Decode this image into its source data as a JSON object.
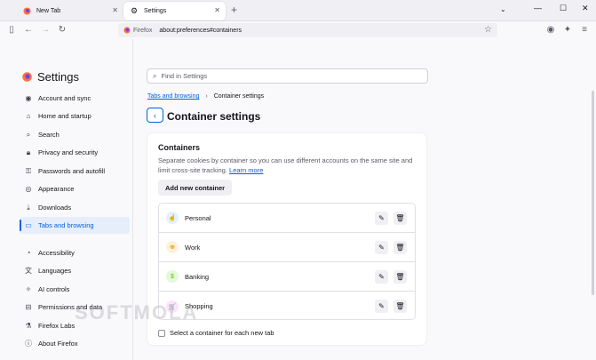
{
  "tabs": [
    {
      "label": "New Tab",
      "icon": "firefox-icon"
    },
    {
      "label": "Settings",
      "icon": "gear-icon"
    }
  ],
  "urlbar": {
    "identity": "Firefox",
    "url": "about:preferences#containers"
  },
  "sidebar": {
    "title": "Settings",
    "items": [
      {
        "label": "Account and sync",
        "icon": "account-icon"
      },
      {
        "label": "Home and startup",
        "icon": "home-icon"
      },
      {
        "label": "Search",
        "icon": "search-icon"
      },
      {
        "label": "Privacy and security",
        "icon": "lock-icon"
      },
      {
        "label": "Passwords and autofill",
        "icon": "key-icon"
      },
      {
        "label": "Appearance",
        "icon": "eye-icon"
      },
      {
        "label": "Downloads",
        "icon": "download-icon"
      },
      {
        "label": "Tabs and browsing",
        "icon": "tabs-icon",
        "selected": true
      },
      {
        "label": "Accessibility",
        "icon": "accessibility-icon"
      },
      {
        "label": "Languages",
        "icon": "translate-icon"
      },
      {
        "label": "AI controls",
        "icon": "sparkle-icon"
      },
      {
        "label": "Permissions and data",
        "icon": "permissions-icon"
      },
      {
        "label": "Firefox Labs",
        "icon": "flask-icon"
      },
      {
        "label": "About Firefox",
        "icon": "info-icon"
      }
    ]
  },
  "search": {
    "placeholder": "Find in Settings"
  },
  "breadcrumb": {
    "parent": "Tabs and browsing",
    "current": "Container settings"
  },
  "page_title": "Container settings",
  "containers": {
    "heading": "Containers",
    "description": "Separate cookies by container so you can use different accounts on the same site and limit cross-site tracking.",
    "learn_more": "Learn more",
    "add_label": "Add new container",
    "items": [
      {
        "name": "Personal",
        "icon": "fingerprint-icon",
        "color": "#37adff",
        "bg": "#e0f2ff",
        "glyph": "☝"
      },
      {
        "name": "Work",
        "icon": "briefcase-icon",
        "color": "#ff9f00",
        "bg": "#fff1dc",
        "glyph": "♚"
      },
      {
        "name": "Banking",
        "icon": "dollar-icon",
        "color": "#51cd00",
        "bg": "#e5f8d8",
        "glyph": "$"
      },
      {
        "name": "Shopping",
        "icon": "cart-icon",
        "color": "#ff4bda",
        "bg": "#ffe2f8",
        "glyph": "🛒"
      }
    ],
    "checkbox_label": "Select a container for each new tab"
  },
  "watermark": "SOFTMOLA"
}
